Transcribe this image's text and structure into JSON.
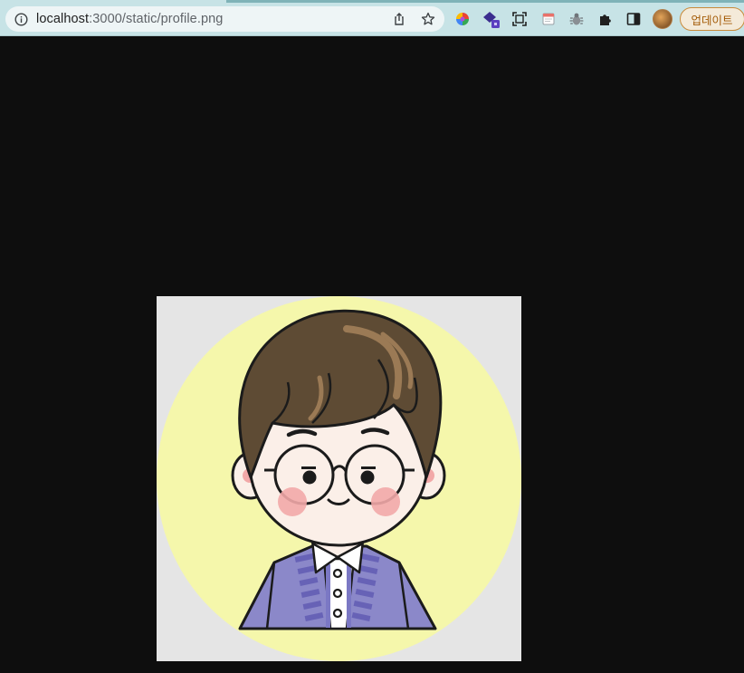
{
  "browser": {
    "url_host": "localhost",
    "url_path": ":3000/static/profile.png",
    "update_label": "업데이트",
    "icons": {
      "site_info": "info-icon",
      "share": "share-icon",
      "bookmark": "star-icon",
      "extension_1": "color-wheel-extension-icon",
      "extension_2": "layered-squares-extension-icon",
      "extension_3": "screenshot-capture-icon",
      "extension_4": "calendar-extension-icon",
      "extension_5": "bug-extension-icon",
      "extensions_menu": "puzzle-icon",
      "side_panel": "side-panel-icon",
      "profile": "avatar"
    }
  },
  "image": {
    "content": "cartoon profile illustration",
    "colors": {
      "background": "#e5e5e5",
      "circle": "#f5f7ab",
      "hair": "#5e4b34",
      "skin": "#fbefe8",
      "cheek": "#f2a8a8",
      "jacket": "#8b88c9",
      "jacket_stripes": "#6762b6",
      "outline": "#1b1b1b"
    }
  }
}
